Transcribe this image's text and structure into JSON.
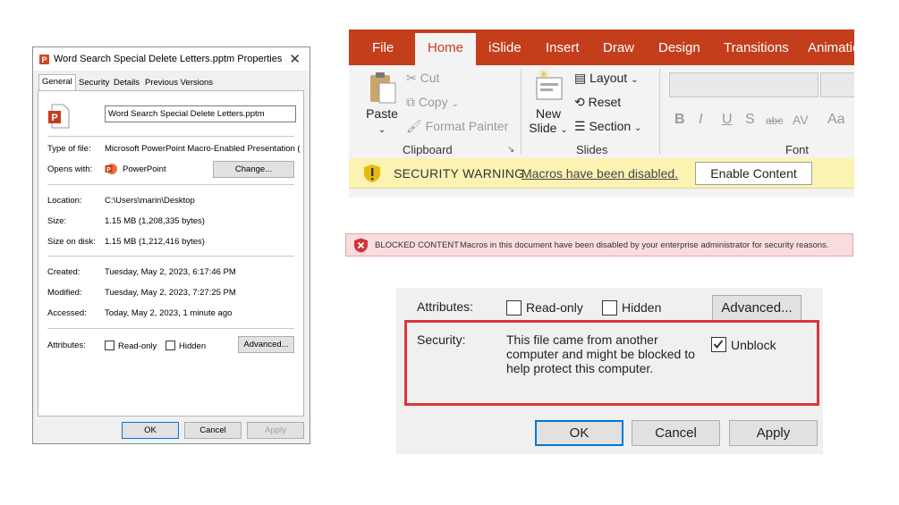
{
  "properties_dialog": {
    "title": "Word Search Special Delete Letters.pptm Properties",
    "close_glyph": "✕",
    "tabs": [
      "General",
      "Security",
      "Details",
      "Previous Versions"
    ],
    "file_name": "Word Search Special Delete Letters.pptm",
    "type_label": "Type of file:",
    "type_value": "Microsoft PowerPoint Macro-Enabled Presentation (.",
    "opens_label": "Opens with:",
    "opens_value": "PowerPoint",
    "change_button": "Change...",
    "location_label": "Location:",
    "location_value": "C:\\Users\\marin\\Desktop",
    "size_label": "Size:",
    "size_value": "1.15 MB (1,208,335 bytes)",
    "size_disk_label": "Size on disk:",
    "size_disk_value": "1.15 MB (1,212,416 bytes)",
    "created_label": "Created:",
    "created_value": "Tuesday, May 2, 2023, 6:17:46 PM",
    "modified_label": "Modified:",
    "modified_value": "Tuesday, May 2, 2023, 7:27:25 PM",
    "accessed_label": "Accessed:",
    "accessed_value": "Today, May 2, 2023, 1 minute ago",
    "attributes_label": "Attributes:",
    "readonly_label": "Read-only",
    "hidden_label": "Hidden",
    "advanced_button": "Advanced...",
    "ok_button": "OK",
    "cancel_button": "Cancel",
    "apply_button": "Apply"
  },
  "ribbon": {
    "tabs": [
      "File",
      "Home",
      "iSlide",
      "Insert",
      "Draw",
      "Design",
      "Transitions",
      "Animatio"
    ],
    "active_tab": "Home",
    "clipboard": {
      "paste": "Paste",
      "cut": "Cut",
      "copy": "Copy",
      "format_painter": "Format Painter",
      "group": "Clipboard"
    },
    "slides": {
      "new_slide_1": "New",
      "new_slide_2": "Slide",
      "layout": "Layout",
      "reset": "Reset",
      "section": "Section",
      "group": "Slides"
    },
    "font": {
      "group": "Font",
      "bold": "B",
      "italic": "I",
      "underline": "U",
      "shadow": "S",
      "strike": "abc",
      "spacing": "AV",
      "case": "Aa"
    },
    "security_bar": {
      "title": "SECURITY WARNING",
      "message": "Macros have been disabled.",
      "button": "Enable Content"
    },
    "accent_color": "#c43e1c"
  },
  "blocked_bar": {
    "title": "BLOCKED CONTENT",
    "message": "Macros in this document have been disabled by your enterprise administrator for security reasons."
  },
  "zoom_panel": {
    "attributes_label": "Attributes:",
    "readonly_label": "Read-only",
    "hidden_label": "Hidden",
    "advanced_button": "Advanced...",
    "security_label": "Security:",
    "security_line1": "This file came from another",
    "security_line2": "computer and might be blocked to",
    "security_line3": "help protect this computer.",
    "unblock_label": "Unblock",
    "unblock_checked": true,
    "ok_button": "OK",
    "cancel_button": "Cancel",
    "apply_button": "Apply"
  }
}
